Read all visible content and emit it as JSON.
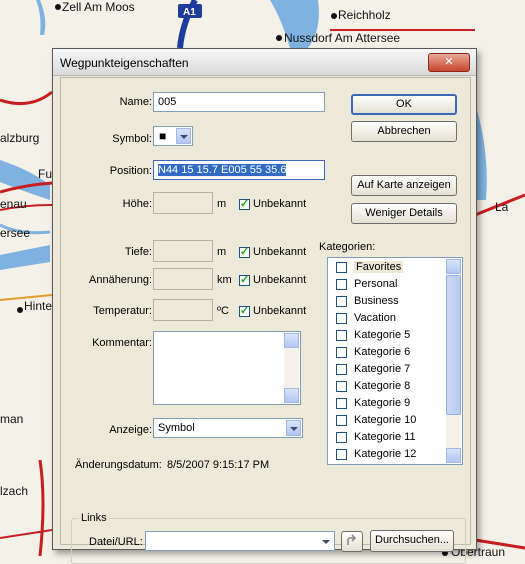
{
  "map": {
    "labels": [
      "Zell Am Moos",
      "Reichholz",
      "Nussdorf Am Attersee",
      "alzburg",
      "Fu",
      "enau",
      "ersee",
      "Hinte",
      "man",
      "lzach",
      "Obertraun",
      "La"
    ],
    "road_badge": "A1"
  },
  "dialog": {
    "title": "Wegpunkteigenschaften",
    "close_glyph": "✕",
    "name_label": "Name:",
    "name_value": "005",
    "symbol_label": "Symbol:",
    "symbol_glyph": "■",
    "position_label": "Position:",
    "position_value": "N44 15 15.7 E005 55 35.6",
    "hoehe_label": "Höhe:",
    "hoehe_unit": "m",
    "unbekannt": "Unbekannt",
    "tiefe_label": "Tiefe:",
    "tiefe_unit": "m",
    "annaeherung_label": "Annäherung:",
    "annaeherung_unit": "km",
    "temperatur_label": "Temperatur:",
    "temperatur_unit": "ºC",
    "kommentar_label": "Kommentar:",
    "anzeige_label": "Anzeige:",
    "anzeige_value": "Symbol",
    "datum_label": "Änderungsdatum:",
    "datum_value": "8/5/2007 9:15:17 PM",
    "links_group": "Links",
    "url_label": "Datei/URL:",
    "buttons": {
      "ok": "OK",
      "cancel": "Abbrechen",
      "show_on_map": "Auf Karte anzeigen",
      "less_details": "Weniger Details",
      "browse": "Durchsuchen..."
    },
    "kategorien_label": "Kategorien:",
    "categories": [
      "Favorites",
      "Personal",
      "Business",
      "Vacation",
      "Kategorie 5",
      "Kategorie 6",
      "Kategorie 7",
      "Kategorie 8",
      "Kategorie 9",
      "Kategorie 10",
      "Kategorie 11",
      "Kategorie 12"
    ]
  },
  "colors": {
    "selection": "#316ac5",
    "default_button_border": "#3c68b8",
    "map_water": "#7fb2e0",
    "map_road_red": "#c81e1e",
    "highway_blue": "#1e3c9c"
  }
}
